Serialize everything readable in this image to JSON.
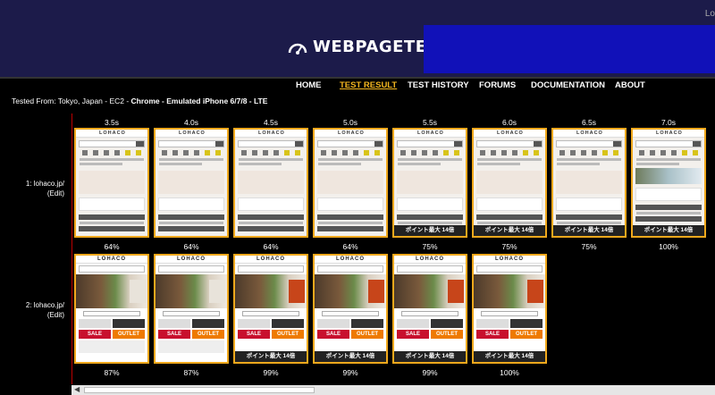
{
  "header": {
    "brand": "WEBPAGETEST",
    "topright": "Lo"
  },
  "nav": [
    "HOME",
    "TEST RESULT",
    "TEST HISTORY",
    "FORUMS",
    "DOCUMENTATION",
    "ABOUT"
  ],
  "tested": {
    "prefix": "Tested From: Tokyo, Japan - EC2 - ",
    "browser": "Chrome - Emulated iPhone 6/7/8 - LTE"
  },
  "times": [
    "3.5s",
    "4.0s",
    "4.5s",
    "5.0s",
    "5.5s",
    "6.0s",
    "6.5s",
    "7.0s"
  ],
  "rows": [
    {
      "label_line1": "1: lohaco.jp/",
      "label_line2": "(Edit)",
      "percents": [
        "64%",
        "64%",
        "64%",
        "64%",
        "75%",
        "75%",
        "75%",
        "100%"
      ]
    },
    {
      "label_line1": "2: lohaco.jp/",
      "label_line2": "(Edit)",
      "percents": [
        "87%",
        "87%",
        "99%",
        "99%",
        "99%",
        "100%"
      ]
    }
  ],
  "frame_text": {
    "logo": "LOHACO",
    "promo": "ポイント最大 14倍",
    "sale": "SALE",
    "outlet": "OUTLET"
  }
}
